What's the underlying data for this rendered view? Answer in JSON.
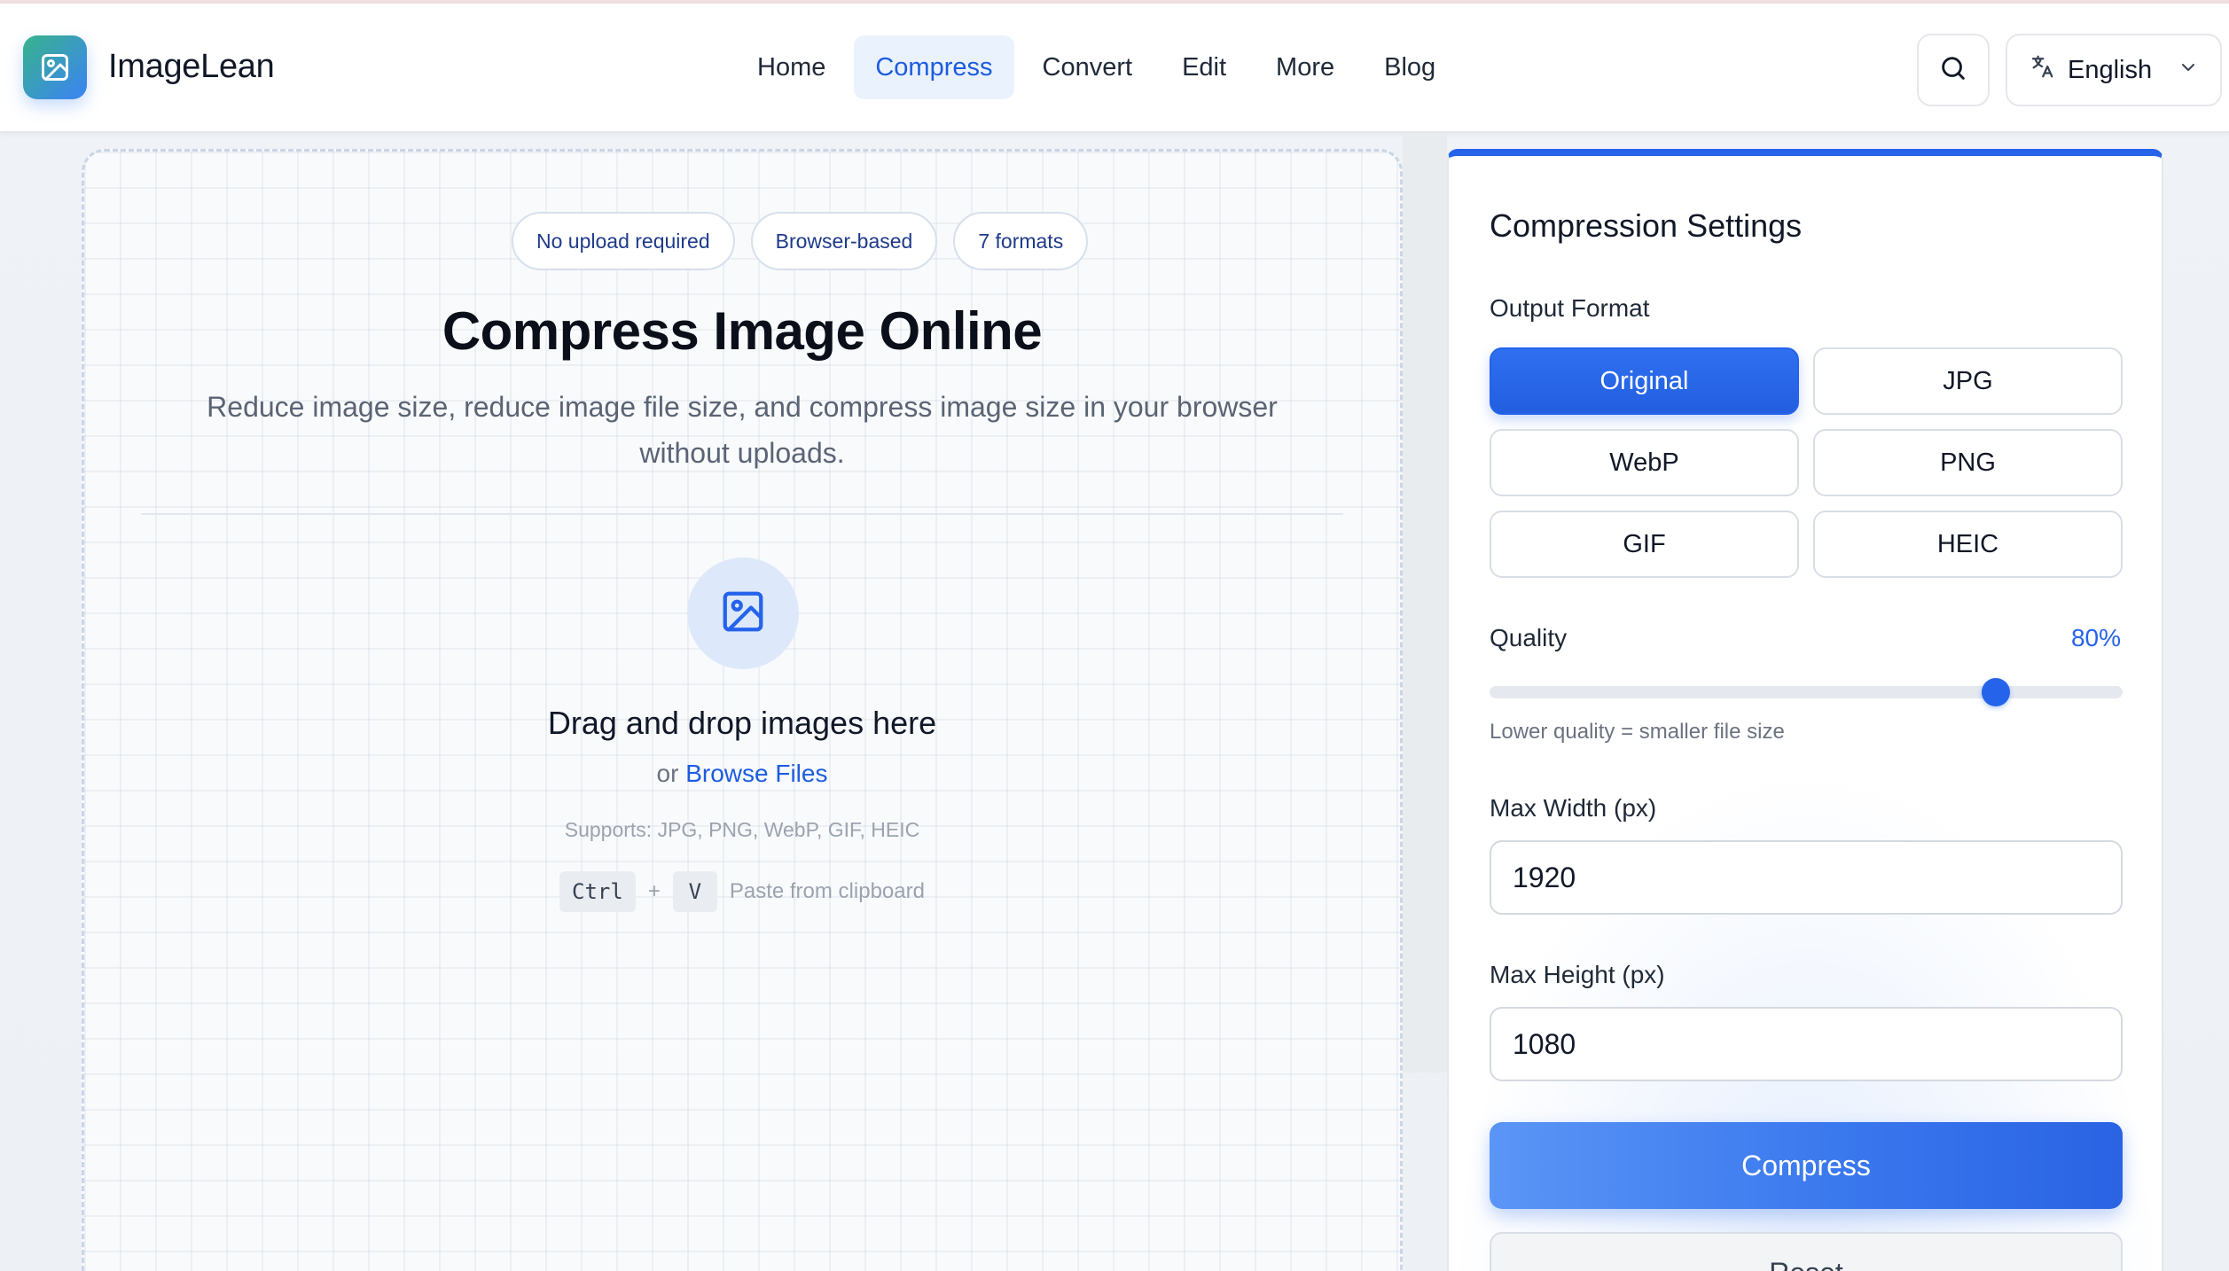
{
  "brand": {
    "name": "ImageLean"
  },
  "nav": {
    "items": [
      {
        "label": "Home",
        "active": false
      },
      {
        "label": "Compress",
        "active": true
      },
      {
        "label": "Convert",
        "active": false
      },
      {
        "label": "Edit",
        "active": false
      },
      {
        "label": "More",
        "active": false
      },
      {
        "label": "Blog",
        "active": false
      }
    ]
  },
  "header": {
    "language": "English"
  },
  "hero": {
    "pills": [
      "No upload required",
      "Browser-based",
      "7 formats"
    ],
    "title": "Compress Image Online",
    "subtitle": "Reduce image size, reduce image file size, and compress image size in your browser without uploads."
  },
  "dropzone": {
    "title": "Drag and drop images here",
    "or": "or",
    "browse": "Browse Files",
    "supports": "Supports: JPG, PNG, WebP, GIF, HEIC",
    "key_ctrl": "Ctrl",
    "plus": "+",
    "key_v": "V",
    "paste_hint": "Paste from clipboard"
  },
  "settings": {
    "title": "Compression Settings",
    "output_format_label": "Output Format",
    "formats": [
      {
        "label": "Original",
        "selected": true
      },
      {
        "label": "JPG",
        "selected": false
      },
      {
        "label": "WebP",
        "selected": false
      },
      {
        "label": "PNG",
        "selected": false
      },
      {
        "label": "GIF",
        "selected": false
      },
      {
        "label": "HEIC",
        "selected": false
      }
    ],
    "quality_label": "Quality",
    "quality_value": "80%",
    "quality": 80,
    "quality_hint": "Lower quality = smaller file size",
    "max_width_label": "Max Width (px)",
    "max_width": "1920",
    "max_height_label": "Max Height (px)",
    "max_height": "1080",
    "compress_label": "Compress",
    "reset_label": "Reset"
  },
  "colors": {
    "accent": "#2563eb",
    "nav_active_bg": "#eaf2fd"
  }
}
